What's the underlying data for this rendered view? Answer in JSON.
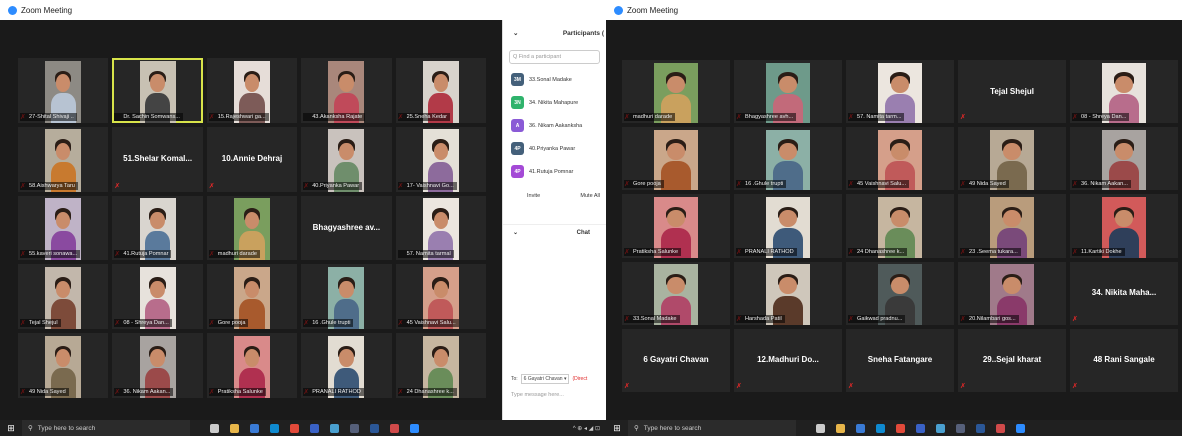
{
  "left": {
    "window_title": "Zoom Meeting",
    "tiles": [
      {
        "label": "27-Shital Shivaji ..",
        "mic_muted": true,
        "video": true,
        "wall": "#8d8a84",
        "shirt": "#b7c3d2"
      },
      {
        "label": "Dr. Sachin Somwans...",
        "mic_muted": false,
        "video": true,
        "active": true,
        "wall": "#c8c1b3",
        "shirt": "#444444"
      },
      {
        "label": "15.Rajeshwari ga...",
        "mic_muted": true,
        "video": true,
        "wall": "#e6ddd8",
        "shirt": "#7d5b58"
      },
      {
        "label": "43.Akanksha Rajate",
        "mic_muted": false,
        "video": true,
        "wall": "#a9877b",
        "shirt": "#c04a5a"
      },
      {
        "label": "25.Sneha Kedar",
        "mic_muted": true,
        "video": true,
        "wall": "#d8d3cc",
        "shirt": "#b23a48"
      },
      {
        "label": "58.Aishwarya Taru",
        "mic_muted": true,
        "video": true,
        "wall": "#b6ad9c",
        "shirt": "#c87a2f"
      },
      {
        "bigname": "51.Shelar Komal...",
        "label": "",
        "mic_muted": true,
        "video": false
      },
      {
        "bigname": "10.Annie Dehraj",
        "label": "",
        "mic_muted": true,
        "video": false
      },
      {
        "label": "40.Priyanka Pawar",
        "mic_muted": true,
        "video": true,
        "wall": "#c9c2bd",
        "shirt": "#6f8e6c"
      },
      {
        "label": "17- Vaishnavi Go...",
        "mic_muted": true,
        "video": true,
        "wall": "#e4e0d7",
        "shirt": "#8d6b9c"
      },
      {
        "label": "55.kaveri sonawa...",
        "mic_muted": true,
        "video": true,
        "wall": "#bfb3c7",
        "shirt": "#8a4aa0"
      },
      {
        "label": "41.Rutuja Pomnar",
        "mic_muted": true,
        "video": true,
        "wall": "#d9d5cf",
        "shirt": "#5a7a9c"
      },
      {
        "label": "madhuri darade",
        "mic_muted": true,
        "video": true,
        "wall": "#7a9e5e",
        "shirt": "#c9a15e"
      },
      {
        "bigname": "Bhagyashree av...",
        "label": "",
        "mic_muted": false,
        "video": false
      },
      {
        "label": "57. Namita tarmal",
        "mic_muted": false,
        "video": true,
        "wall": "#ece6df",
        "shirt": "#9a7fb0"
      },
      {
        "label": "Tejal Shejul",
        "mic_muted": true,
        "video": true,
        "wall": "#c2b7ab",
        "shirt": "#7d4b3a"
      },
      {
        "label": "08 - Shreya Dan...",
        "mic_muted": true,
        "video": true,
        "wall": "#e7e2dc",
        "shirt": "#b86d8c"
      },
      {
        "label": "Gore pooja",
        "mic_muted": true,
        "video": true,
        "wall": "#caa78a",
        "shirt": "#a85a2d"
      },
      {
        "label": "16 .Ghule trupti",
        "mic_muted": true,
        "video": true,
        "wall": "#8cb0a6",
        "shirt": "#4f6d8a"
      },
      {
        "label": "45 Vaishnavi Salu...",
        "mic_muted": true,
        "video": true,
        "wall": "#d59f8a",
        "shirt": "#c05a5a"
      },
      {
        "label": "49 Nida Sayed",
        "mic_muted": true,
        "video": true,
        "wall": "#b7a995",
        "shirt": "#7a6a4f"
      },
      {
        "label": "36. Nikam Aakan...",
        "mic_muted": true,
        "video": true,
        "wall": "#a8a3a0",
        "shirt": "#9b4a4a"
      },
      {
        "label": "Pratiksha Salunke",
        "mic_muted": true,
        "video": true,
        "wall": "#d98a8a",
        "shirt": "#b03050"
      },
      {
        "label": "PRANALI RATHOD",
        "mic_muted": true,
        "video": true,
        "wall": "#e2dcd2",
        "shirt": "#3e5a7a"
      },
      {
        "label": "24 Dhanashree k...",
        "mic_muted": true,
        "video": true,
        "wall": "#c6b6a0",
        "shirt": "#6a8d5a"
      }
    ],
    "panel": {
      "title": "Participants (",
      "search_placeholder": "Q Find a participant",
      "participants": [
        {
          "initials": "3M",
          "name": "33.Sonal Madake",
          "color": "#44607a"
        },
        {
          "initials": "3N",
          "name": "34. Nikita Mahapure",
          "color": "#2fb36c"
        },
        {
          "initials": "A",
          "name": "36. Nikam Aakanksha",
          "color": "#8a5ad6"
        },
        {
          "initials": "4P",
          "name": "40.Priyanka Pawar",
          "color": "#44607a"
        },
        {
          "initials": "4P",
          "name": "41.Rutuja Pomnar",
          "color": "#a44ad6"
        }
      ],
      "invite_label": "Invite",
      "mute_all_label": "Mute All",
      "chat_title": "Chat",
      "to_label": "To:",
      "to_value": "6 Gayatri Chavan ▾",
      "direct_label": "(Direct",
      "message_placeholder": "Type message here..."
    },
    "taskbar": {
      "search_placeholder": "Type here to search",
      "tray_text": "^ ⊕ ◂ ◢ ⊡"
    }
  },
  "right": {
    "window_title": "Zoom Meeting",
    "tiles": [
      {
        "label": "madhuri darade",
        "mic_muted": true,
        "video": true,
        "wall": "#7a9e5e",
        "shirt": "#c9a15e"
      },
      {
        "label": "Bhagyashree avh...",
        "mic_muted": true,
        "video": true,
        "wall": "#6e9a8a",
        "shirt": "#c26a7a"
      },
      {
        "label": "57. Namita tarm...",
        "mic_muted": true,
        "video": true,
        "wall": "#ece6df",
        "shirt": "#9a7fb0"
      },
      {
        "bigname": "Tejal Shejul",
        "label": "",
        "mic_muted": true,
        "video": false
      },
      {
        "label": "08 - Shreya Dan...",
        "mic_muted": true,
        "video": true,
        "wall": "#e7e2dc",
        "shirt": "#b86d8c"
      },
      {
        "label": "Gore pooja",
        "mic_muted": true,
        "video": true,
        "wall": "#caa78a",
        "shirt": "#a85a2d"
      },
      {
        "label": "16 .Ghule trupti",
        "mic_muted": true,
        "video": true,
        "wall": "#8cb0a6",
        "shirt": "#4f6d8a"
      },
      {
        "label": "45 Vaishnavi Salu...",
        "mic_muted": true,
        "video": true,
        "wall": "#d59f8a",
        "shirt": "#c05a5a"
      },
      {
        "label": "49 Nida Sayed",
        "mic_muted": true,
        "video": true,
        "wall": "#b7a995",
        "shirt": "#7a6a4f"
      },
      {
        "label": "36. Nikam Aakan...",
        "mic_muted": true,
        "video": true,
        "wall": "#a8a3a0",
        "shirt": "#9b4a4a"
      },
      {
        "label": "Pratiksha Salunke",
        "mic_muted": true,
        "video": true,
        "wall": "#d98a8a",
        "shirt": "#b03050"
      },
      {
        "label": "PRANALI RATHOD",
        "mic_muted": true,
        "video": true,
        "wall": "#e2dcd2",
        "shirt": "#3e5a7a"
      },
      {
        "label": "24 Dhanashree k...",
        "mic_muted": true,
        "video": true,
        "wall": "#c6b6a0",
        "shirt": "#6a8d5a"
      },
      {
        "label": "23 .Seema tukara...",
        "mic_muted": true,
        "video": true,
        "wall": "#b99c7c",
        "shirt": "#7a4a7a"
      },
      {
        "label": "11.Kartiki Dokhe",
        "mic_muted": true,
        "video": true,
        "wall": "#d25a5a",
        "shirt": "#2f3f5a"
      },
      {
        "label": "33.Sonal Madake",
        "mic_muted": true,
        "video": true,
        "wall": "#a9b3a0",
        "shirt": "#b04a6a"
      },
      {
        "label": "Harshada Patil",
        "mic_muted": true,
        "video": true,
        "wall": "#cfc7bb",
        "shirt": "#5a3a2a"
      },
      {
        "label": "Gaikwad pradnu...",
        "mic_muted": true,
        "video": true,
        "wall": "#4f5a5a",
        "shirt": "#3a3a3a"
      },
      {
        "label": "20.Nilambari gos...",
        "mic_muted": true,
        "video": true,
        "wall": "#a07a8a",
        "shirt": "#8a3a6a"
      },
      {
        "bigname": "34. Nikita Maha...",
        "label": "",
        "mic_muted": true,
        "video": false
      },
      {
        "bigname": "6 Gayatri Chavan",
        "label": "",
        "mic_muted": true,
        "video": false
      },
      {
        "bigname": "12.Madhuri Do...",
        "label": "",
        "mic_muted": true,
        "video": false
      },
      {
        "bigname": "Sneha Fatangare",
        "label": "",
        "mic_muted": true,
        "video": false
      },
      {
        "bigname": "29..Sejal kharat",
        "label": "",
        "mic_muted": true,
        "video": false
      },
      {
        "bigname": "48 Rani Sangale",
        "label": "",
        "mic_muted": true,
        "video": false
      }
    ],
    "taskbar": {
      "search_placeholder": "Type here to search"
    }
  },
  "taskbar_apps": [
    "task-view-icon",
    "file-explorer-icon",
    "store-icon",
    "edge-icon",
    "chrome-icon",
    "firefox-icon",
    "paint-icon",
    "calculator-icon",
    "word-icon",
    "photos-icon",
    "zoom-icon"
  ],
  "taskbar_app_colors": [
    "#cccccc",
    "#e8b64a",
    "#3a7bd5",
    "#0f8ad0",
    "#e24a3a",
    "#3a62c6",
    "#4aa0d0",
    "#56607a",
    "#2b5797",
    "#d04a4a",
    "#2d8cff"
  ]
}
